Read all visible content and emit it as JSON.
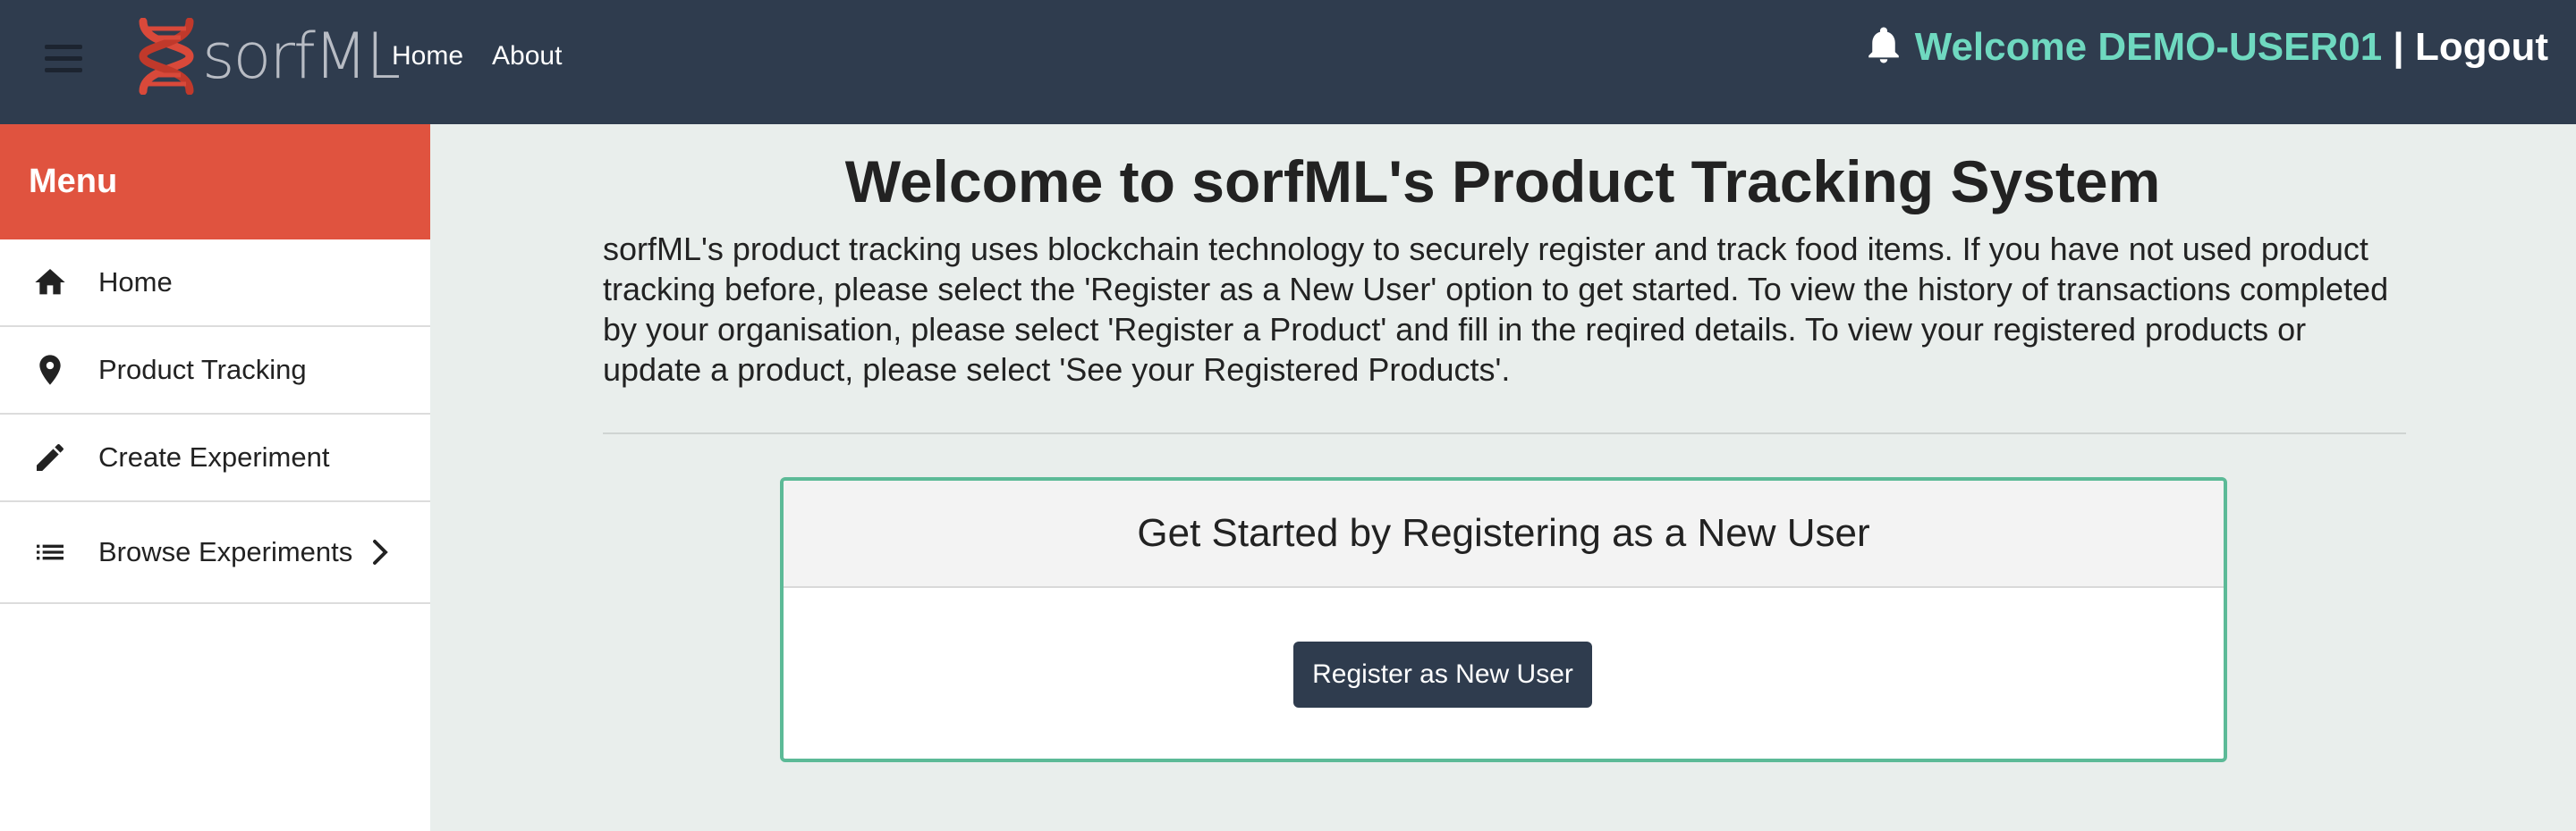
{
  "header": {
    "logo_text": "sorfML",
    "nav": [
      {
        "label": "Home"
      },
      {
        "label": "About"
      }
    ],
    "welcome_prefix": "Welcome",
    "username": "DEMO-USER01",
    "separator": "|",
    "logout_label": "Logout"
  },
  "sidebar": {
    "menu_title": "Menu",
    "items": [
      {
        "label": "Home",
        "icon": "home-icon"
      },
      {
        "label": "Product Tracking",
        "icon": "location-pin-icon"
      },
      {
        "label": "Create Experiment",
        "icon": "pencil-icon"
      },
      {
        "label": "Browse Experiments",
        "icon": "list-icon",
        "has_submenu": true
      }
    ]
  },
  "main": {
    "title": "Welcome to sorfML's Product Tracking System",
    "intro": "sorfML's product tracking uses blockchain technology to securely register and track food items. If you have not used product tracking before, please select the 'Register as a New User' option to get started. To view the history of transactions completed by your organisation, please select 'Register a Product' and fill in the reqired details. To view your registered products or update a product, please select 'See your Registered Products'.",
    "card": {
      "title": "Get Started by Registering as a New User",
      "button_label": "Register as New User"
    }
  },
  "colors": {
    "topbar": "#2f3c4e",
    "menu_header": "#e0533f",
    "username": "#6fd9c0",
    "card_border": "#5cba97",
    "button": "#2f3c4e"
  }
}
